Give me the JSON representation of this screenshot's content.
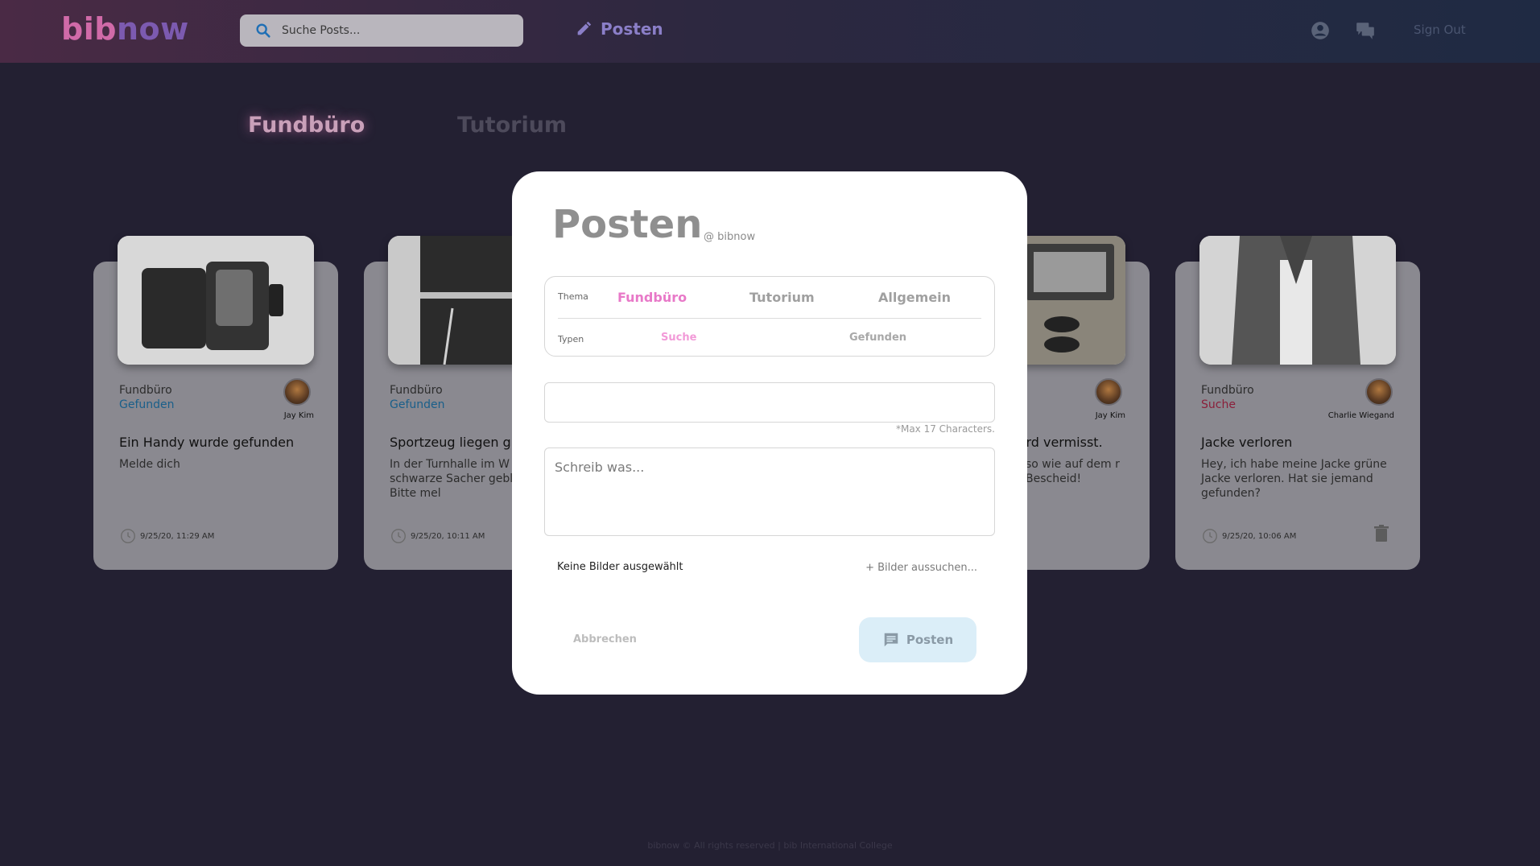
{
  "header": {
    "logo_part1": "bib",
    "logo_part2": "now",
    "search_placeholder": "Suche Posts...",
    "post_link": "Posten",
    "sign_out": "Sign Out"
  },
  "tabs": [
    {
      "label": "Fundbüro",
      "active": true
    },
    {
      "label": "Tutorium",
      "active": false
    }
  ],
  "cards": [
    {
      "category": "Fundbüro",
      "type": "Gefunden",
      "author": "Jay Kim",
      "title": "Ein Handy wurde gefunden",
      "text": "Melde dich",
      "time": "9/25/20, 11:29 AM"
    },
    {
      "category": "Fundbüro",
      "type": "Gefunden",
      "author": "",
      "title": "Sportzeug liegen g",
      "text": "In der Turnhalle im W sind schwarze Sacher geblieben... Bitte mel",
      "time": "9/25/20, 10:11 AM"
    },
    {
      "category": "",
      "type": "",
      "author": "Jay Kim",
      "title": "ird vermisst.",
      "text": "so wie auf dem r Bescheid!",
      "time": ""
    },
    {
      "category": "Fundbüro",
      "type": "Suche",
      "author": "Charlie Wiegand",
      "title": "Jacke verloren",
      "text": "Hey, ich habe meine Jacke grüne Jacke verloren. Hat sie jemand gefunden?",
      "time": "9/25/20, 10:06 AM"
    }
  ],
  "modal": {
    "title": "Posten",
    "subtitle": "@ bibnow",
    "thema_label": "Thema",
    "topics": [
      "Fundbüro",
      "Tutorium",
      "Allgemein"
    ],
    "selected_topic": "Fundbüro",
    "typen_label": "Typen",
    "types": [
      "Suche",
      "Gefunden"
    ],
    "selected_type": "Suche",
    "title_value": "",
    "max_note": "*Max 17 Characters.",
    "text_placeholder": "Schreib was...",
    "no_images": "Keine Bilder ausgewählt",
    "pick_images": "+ Bilder aussuchen...",
    "cancel": "Abbrechen",
    "submit": "Posten"
  },
  "footer": "bibnow © All rights reserved | bib International College",
  "colors": {
    "accent_pink": "#e879c8",
    "found_blue": "#1a5f8a",
    "search_red": "#8a1f3a"
  }
}
